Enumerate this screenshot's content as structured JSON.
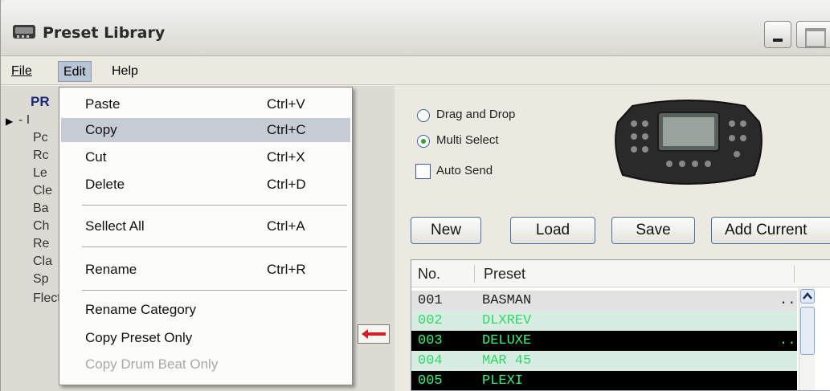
{
  "window": {
    "title": "Preset Library",
    "app_icon": "amp-icon"
  },
  "menubar": {
    "file": "File",
    "edit": "Edit",
    "help": "Help"
  },
  "edit_menu": {
    "items": [
      {
        "label": "Paste",
        "shortcut": "Ctrl+V",
        "state": "normal"
      },
      {
        "label": "Copy",
        "shortcut": "Ctrl+C",
        "state": "highlighted"
      },
      {
        "label": "Cut",
        "shortcut": "Ctrl+X",
        "state": "normal"
      },
      {
        "label": "Delete",
        "shortcut": "Ctrl+D",
        "state": "normal"
      },
      {
        "label": "Sellect All",
        "shortcut": "Ctrl+A",
        "state": "normal"
      },
      {
        "label": "Rename",
        "shortcut": "Ctrl+R",
        "state": "normal"
      },
      {
        "label": "Rename Category",
        "shortcut": "",
        "state": "normal"
      },
      {
        "label": "Copy Preset Only",
        "shortcut": "",
        "state": "normal"
      },
      {
        "label": "Copy Drum Beat Only",
        "shortcut": "",
        "state": "disabled"
      }
    ]
  },
  "left_panel": {
    "header": "PR",
    "rows": [
      "- I",
      "Pc",
      "Rc",
      "Le",
      "Cle",
      "Ba",
      "Ch",
      "Re",
      "Cla",
      "Sp",
      "Flectr"
    ],
    "transfer_icon": "left-arrow-icon"
  },
  "options": {
    "drag_and_drop": {
      "label": "Drag and Drop",
      "checked": false
    },
    "multi_select": {
      "label": "Multi Select",
      "checked": true
    },
    "auto_send": {
      "label": "Auto Send",
      "checked": false
    }
  },
  "buttons": {
    "new": "New",
    "load": "Load",
    "save": "Save",
    "add_current": "Add Current"
  },
  "preset_list": {
    "col_no": "No.",
    "col_preset": "Preset",
    "rows": [
      {
        "no": "001",
        "name": "BASMAN",
        "dots": "...",
        "style": "plain"
      },
      {
        "no": "002",
        "name": "DLXREV",
        "dots": "",
        "style": "green-light"
      },
      {
        "no": "003",
        "name": "DELUXE",
        "dots": "...",
        "style": "sel"
      },
      {
        "no": "004",
        "name": "MAR 45",
        "dots": "",
        "style": "green-light"
      },
      {
        "no": "005",
        "name": "PLEXI",
        "dots": "",
        "style": "sel"
      }
    ]
  },
  "colors": {
    "menu_highlight": "#c7cbd4",
    "selected_row_bg": "#000000",
    "selected_row_text": "#3ef07a",
    "title_text": "#2a2a2a"
  }
}
